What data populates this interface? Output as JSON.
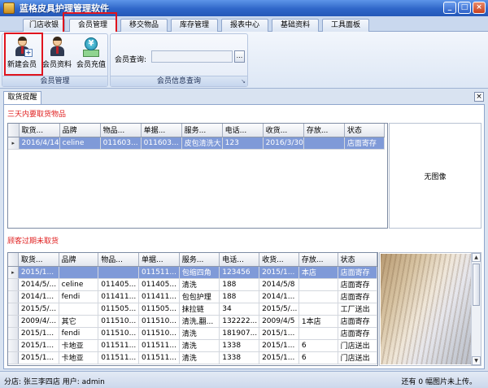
{
  "window": {
    "title": "蓝格皮具护理管理软件",
    "min": "_",
    "max": "□",
    "close": "×"
  },
  "tabs": [
    "门店收银",
    "会员管理",
    "移交物品",
    "库存管理",
    "报表中心",
    "基础资料",
    "工具面板"
  ],
  "ribbon": {
    "member_group": {
      "label": "会员管理",
      "buttons": [
        "新建会员",
        "会员资料",
        "会员充值"
      ]
    },
    "query_group": {
      "label": "会员信息查询",
      "query_label": "会员查询:",
      "browse": "..."
    }
  },
  "doc_tab": {
    "label": "取货提醒",
    "close": "×"
  },
  "section1": {
    "title": "三天内要取货物品",
    "columns": [
      "取货...",
      "品牌",
      "物品...",
      "单据...",
      "服务...",
      "电话...",
      "收货...",
      "存放...",
      "状态"
    ],
    "rows": [
      [
        "2016/4/14",
        "celine",
        "011603...",
        "011603...",
        "皮包清洗大",
        "123",
        "2016/3/30",
        "",
        "店面寄存"
      ]
    ],
    "no_image": "无图像"
  },
  "section2": {
    "title": "顾客过期未取货",
    "columns": [
      "取货...",
      "品牌",
      "物品...",
      "单据...",
      "服务...",
      "电话...",
      "收货...",
      "存放...",
      "状态"
    ],
    "rows": [
      [
        "2015/1...",
        "",
        "",
        "011511...",
        "包缩四角",
        "123456",
        "2015/1...",
        "本店",
        "店面寄存"
      ],
      [
        "2014/5/...",
        "celine",
        "011405...",
        "011405...",
        "清洗",
        "188",
        "2014/5/8",
        "",
        "店面寄存"
      ],
      [
        "2014/1...",
        "fendi",
        "011411...",
        "011411...",
        "包包护理",
        "188",
        "2014/1...",
        "",
        "店面寄存"
      ],
      [
        "2015/5/...",
        "",
        "011505...",
        "011505...",
        "抹拉链",
        "34",
        "2015/5/...",
        "",
        "工厂送出"
      ],
      [
        "2009/4/...",
        "其它",
        "011510...",
        "011510...",
        "清洗,翻...",
        "132222...",
        "2009/4/5",
        "1本店",
        "店面寄存"
      ],
      [
        "2015/1...",
        "fendi",
        "011510...",
        "011510...",
        "清洗",
        "181907...",
        "2015/1...",
        "",
        "店面寄存"
      ],
      [
        "2015/1...",
        "卡地亚",
        "011511...",
        "011511...",
        "清洗",
        "1338",
        "2015/1...",
        "6",
        "门店送出"
      ],
      [
        "2015/1...",
        "卡地亚",
        "011511...",
        "011511...",
        "清洗",
        "1338",
        "2015/1...",
        "6",
        "门店送出"
      ]
    ]
  },
  "status": {
    "left": "分店: 张三李四店  用户: admin",
    "right": "还有 0 幅图片未上传。"
  }
}
